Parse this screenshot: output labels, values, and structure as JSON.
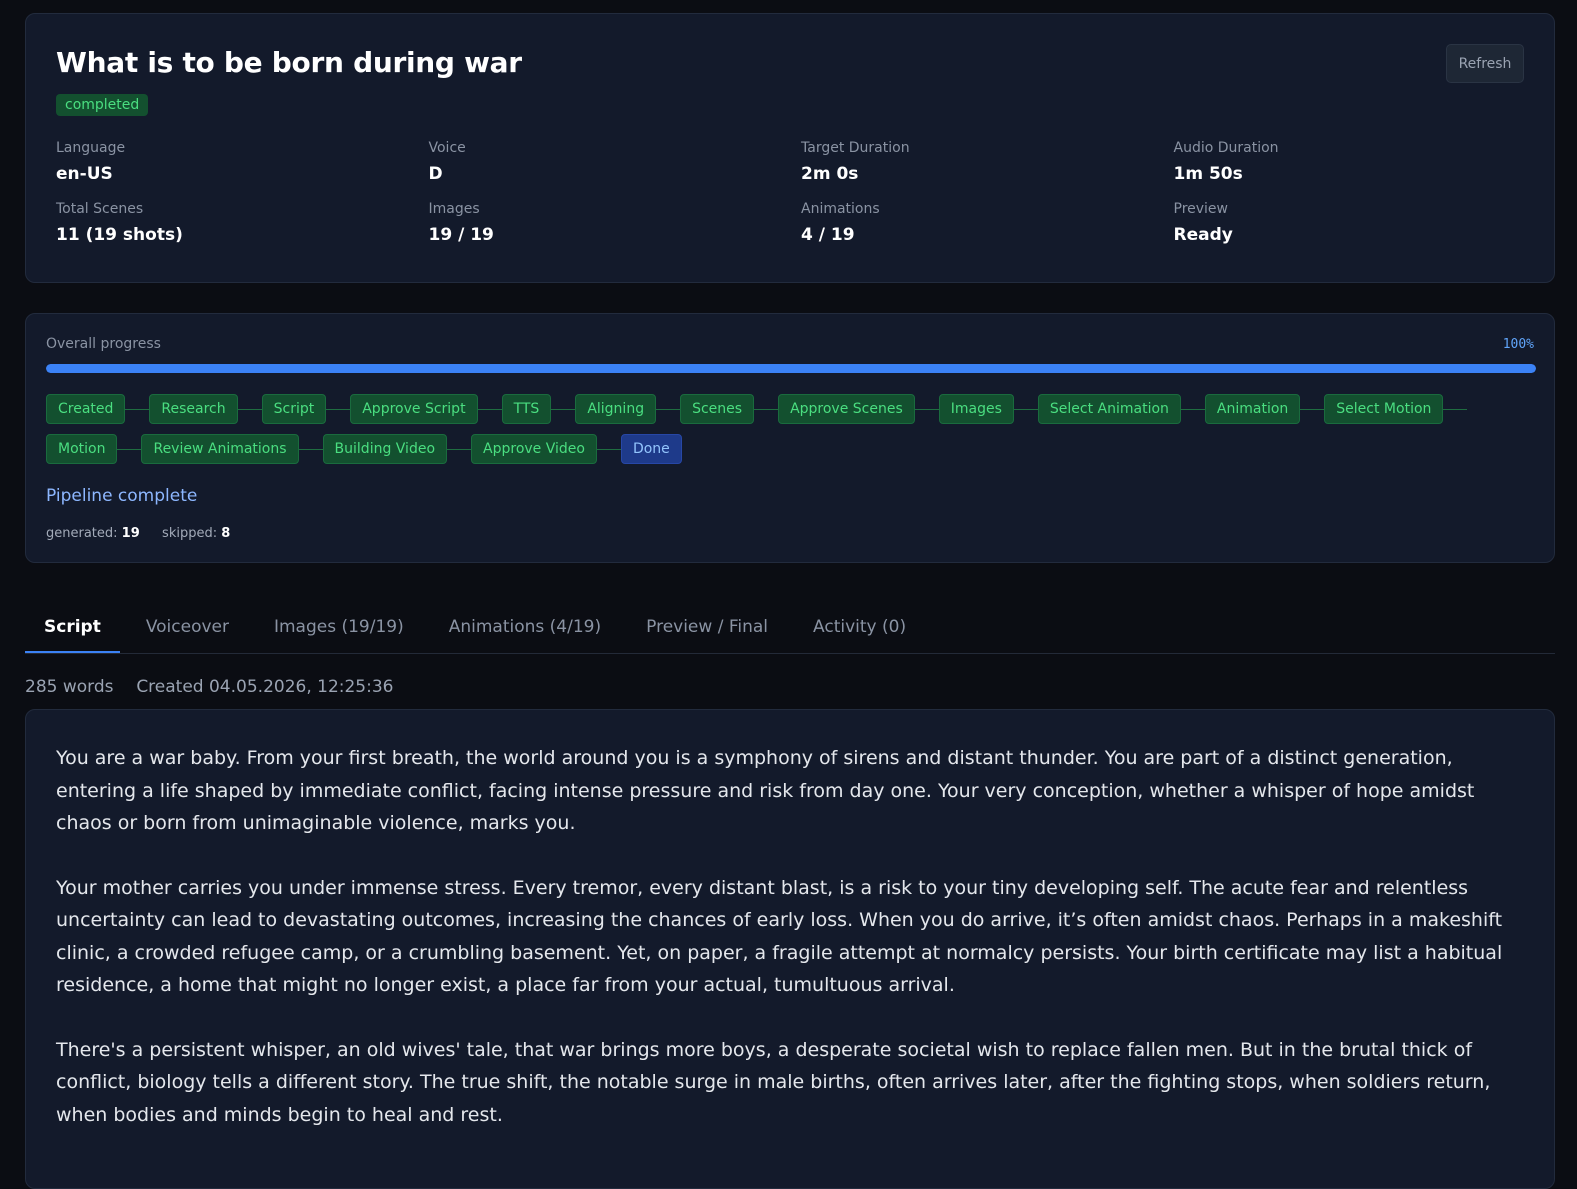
{
  "header": {
    "title": "What is to be born during war",
    "status": "completed",
    "refresh_label": "Refresh",
    "meta": [
      {
        "label": "Language",
        "value": "en-US"
      },
      {
        "label": "Voice",
        "value": "D"
      },
      {
        "label": "Target Duration",
        "value": "2m 0s"
      },
      {
        "label": "Audio Duration",
        "value": "1m 50s"
      },
      {
        "label": "Total Scenes",
        "value": "11 (19 shots)"
      },
      {
        "label": "Images",
        "value": "19 / 19"
      },
      {
        "label": "Animations",
        "value": "4 / 19"
      },
      {
        "label": "Preview",
        "value": "Ready"
      }
    ]
  },
  "progress": {
    "label": "Overall progress",
    "percent_text": "100%",
    "fraction": 1.0,
    "steps": [
      "Created",
      "Research",
      "Script",
      "Approve Script",
      "TTS",
      "Aligning",
      "Scenes",
      "Approve Scenes",
      "Images",
      "Select Animation",
      "Animation",
      "Select Motion",
      "Motion",
      "Review Animations",
      "Building Video",
      "Approve Video",
      "Done"
    ],
    "current_step": "Done",
    "status_text": "Pipeline complete",
    "generated_label": "generated:",
    "generated_value": "19",
    "skipped_label": "skipped:",
    "skipped_value": "8"
  },
  "tabs": [
    {
      "label": "Script",
      "active": true
    },
    {
      "label": "Voiceover",
      "active": false
    },
    {
      "label": "Images (19/19)",
      "active": false
    },
    {
      "label": "Animations (4/19)",
      "active": false
    },
    {
      "label": "Preview / Final",
      "active": false
    },
    {
      "label": "Activity (0)",
      "active": false
    }
  ],
  "script": {
    "word_count": "285 words",
    "created": "Created 04.05.2026, 12:25:36",
    "paragraphs": [
      "You are a war baby. From your first breath, the world around you is a symphony of sirens and distant thunder. You are part of a distinct generation, entering a life shaped by immediate conflict, facing intense pressure and risk from day one. Your very conception, whether a whisper of hope amidst chaos or born from unimaginable violence, marks you.",
      "Your mother carries you under immense stress. Every tremor, every distant blast, is a risk to your tiny developing self. The acute fear and relentless uncertainty can lead to devastating outcomes, increasing the chances of early loss. When you do arrive, it’s often amidst chaos. Perhaps in a makeshift clinic, a crowded refugee camp, or a crumbling basement. Yet, on paper, a fragile attempt at normalcy persists. Your birth certificate may list a habitual residence, a home that might no longer exist, a place far from your actual, tumultuous arrival.",
      "There's a persistent whisper, an old wives' tale, that war brings more boys, a desperate societal wish to replace fallen men. But in the brutal thick of conflict, biology tells a different story. The true shift, the notable surge in male births, often arrives later, after the fighting stops, when soldiers return, when bodies and minds begin to heal and rest."
    ]
  }
}
